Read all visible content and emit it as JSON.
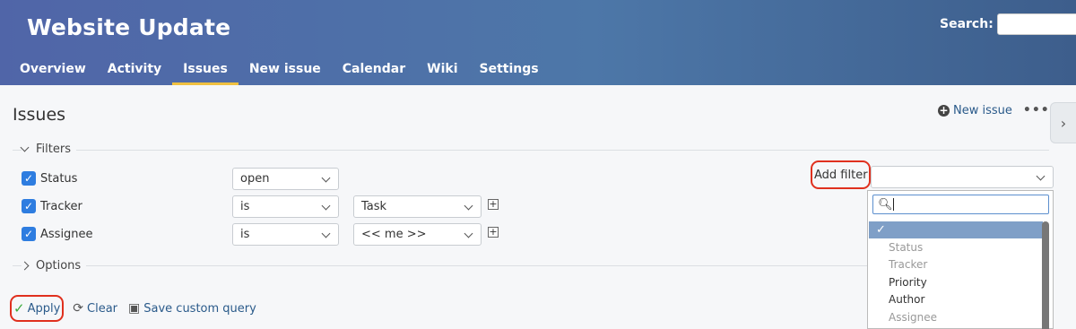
{
  "header": {
    "project_title": "Website Update",
    "search_label": "Search:",
    "tabs": [
      {
        "label": "Overview"
      },
      {
        "label": "Activity"
      },
      {
        "label": "Issues",
        "selected": true
      },
      {
        "label": "New issue"
      },
      {
        "label": "Calendar"
      },
      {
        "label": "Wiki"
      },
      {
        "label": "Settings"
      }
    ]
  },
  "main": {
    "title": "Issues",
    "new_issue_link": "New issue",
    "more_icon": "•••",
    "filters_legend": "Filters",
    "options_legend": "Options",
    "filters": [
      {
        "label": "Status",
        "operator": "open",
        "value": ""
      },
      {
        "label": "Tracker",
        "operator": "is",
        "value": "Task"
      },
      {
        "label": "Assignee",
        "operator": "is",
        "value": "<< me >>"
      }
    ],
    "add_filter_label": "Add filter",
    "dropdown": {
      "selected_mark": "✓",
      "items": [
        {
          "label": "Status",
          "disabled": true
        },
        {
          "label": "Tracker",
          "disabled": true
        },
        {
          "label": "Priority",
          "disabled": false
        },
        {
          "label": "Author",
          "disabled": false
        },
        {
          "label": "Assignee",
          "disabled": true
        }
      ]
    },
    "actions": {
      "apply": "Apply",
      "clear": "Clear",
      "save": "Save custom query"
    }
  },
  "colors": {
    "header_bg": "#4d6aa8",
    "link": "#2a5a8a",
    "highlight": "#e0301e",
    "selected_tab_underline": "#f0c040"
  }
}
